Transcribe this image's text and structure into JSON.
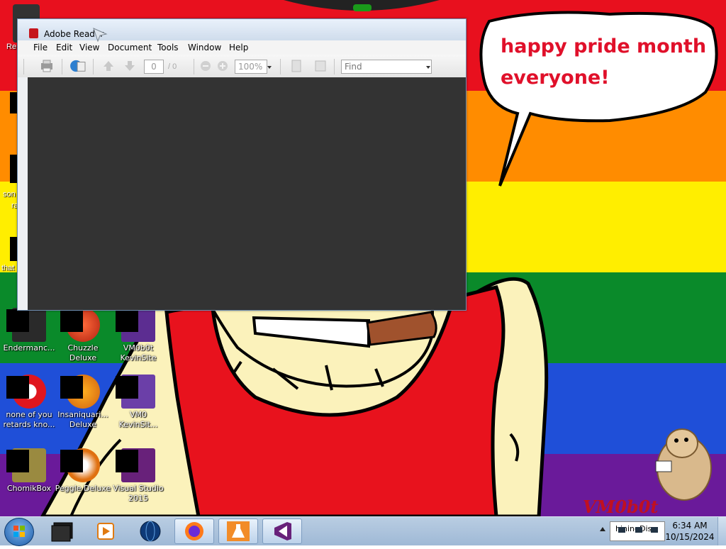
{
  "wallpaper": {
    "bubble_line1": "happy pride month",
    "bubble_line2": "everyone!",
    "signature": "VM0b0t",
    "stripe_colors": [
      "#e8101e",
      "#ff8c00",
      "#ffee00",
      "#0a8a2a",
      "#1f4fd8",
      "#6a1a9a"
    ]
  },
  "left_edge_labels": {
    "a": "Re",
    "b": "son",
    "c": "ra",
    "d": "that"
  },
  "desktop_icons": [
    {
      "label": "Endermanc...",
      "icon": "app-icon"
    },
    {
      "label": "Chuzzle Deluxe",
      "icon": "chuzzle-icon"
    },
    {
      "label": "VM0b0t KevinSite",
      "icon": "visual-studio-solution-icon"
    },
    {
      "label": "none of you retards kno...",
      "icon": "opera-icon"
    },
    {
      "label": "Insaniquari... Deluxe",
      "icon": "insaniquarium-icon"
    },
    {
      "label": "VM0 KevinSit...",
      "icon": "visual-studio-file-icon"
    },
    {
      "label": "ChomikBox",
      "icon": "chomikbox-icon"
    },
    {
      "label": "Peggle Deluxe",
      "icon": "peggle-icon"
    },
    {
      "label": "Visual Studio 2015",
      "icon": "visual-studio-icon"
    }
  ],
  "reader": {
    "title": "Adobe Reader",
    "menu": [
      "File",
      "Edit",
      "View",
      "Document",
      "Tools",
      "Window",
      "Help"
    ],
    "page_current": "0",
    "page_total": "/ 0",
    "zoom": "100%",
    "find_placeholder": "Find"
  },
  "taskbar": {
    "tray_text": "hiningDis",
    "time": "6:34 AM",
    "date": "10/15/2024",
    "pinned": [
      "terminal-icon",
      "media-player-icon",
      "globe-icon",
      "firefox-icon",
      "lab-flask-icon",
      "visual-studio-icon"
    ]
  }
}
